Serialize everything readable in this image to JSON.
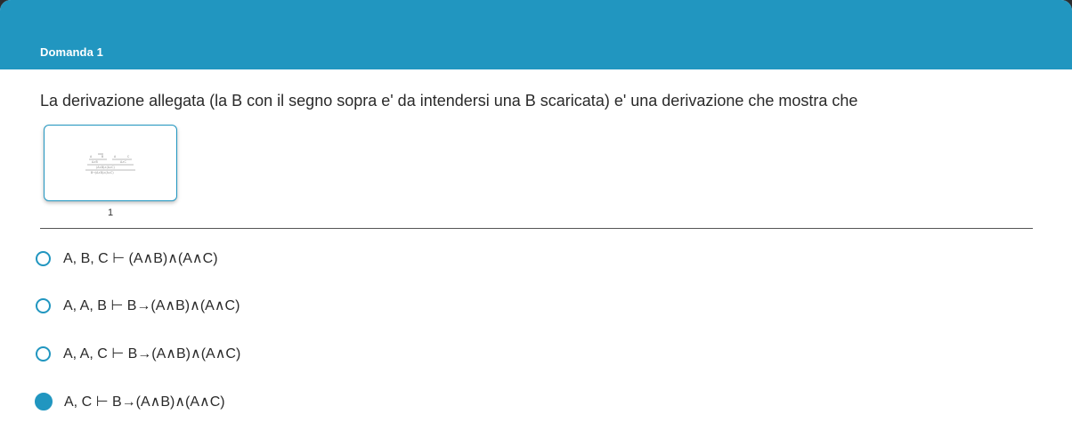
{
  "header": {
    "title": "Domanda 1"
  },
  "question": {
    "text": "La derivazione allegata (la B con il segno sopra e' da intendersi una B scaricata) e' una derivazione che mostra che"
  },
  "attachment": {
    "label": "1"
  },
  "options": [
    {
      "label": "A, B, C ⊢ (A∧B)∧(A∧C)",
      "checked": false
    },
    {
      "label": "A, A, B ⊢ B→(A∧B)∧(A∧C)",
      "checked": false
    },
    {
      "label": "A, A, C ⊢ B→(A∧B)∧(A∧C)",
      "checked": false
    },
    {
      "label": "A, C ⊢ B→(A∧B)∧(A∧C)",
      "checked": true
    }
  ],
  "colors": {
    "accent": "#2196c0",
    "text": "#2a2a2a"
  }
}
